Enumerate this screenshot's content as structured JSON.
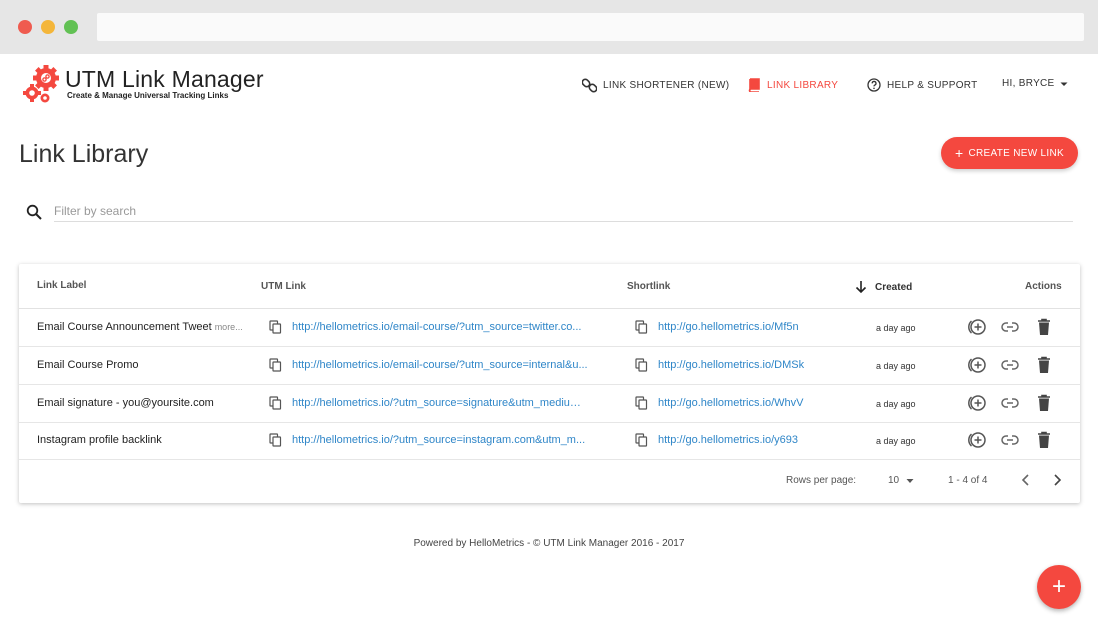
{
  "app": {
    "title": "UTM Link Manager",
    "subtitle": "Create & Manage Universal Tracking Links",
    "accent_color": "#f4483f",
    "link_color": "#2f86c8"
  },
  "nav": {
    "shortener": "LINK SHORTENER (NEW)",
    "library": "LINK LIBRARY",
    "help": "HELP & SUPPORT",
    "user": "HI, BRYCE"
  },
  "page": {
    "title": "Link Library",
    "create_button": "CREATE NEW LINK"
  },
  "search": {
    "placeholder": "Filter by search",
    "value": ""
  },
  "table": {
    "columns": {
      "label": "Link Label",
      "utm": "UTM Link",
      "short": "Shortlink",
      "created": "Created",
      "actions": "Actions"
    },
    "sort": {
      "column": "Created",
      "direction": "descending"
    },
    "rows": [
      {
        "label": "Email Course Announcement Tweet",
        "more": "more...",
        "utm": "http://hellometrics.io/email-course/?utm_source=twitter.co...",
        "short": "http://go.hellometrics.io/Mf5n",
        "created": "a day ago"
      },
      {
        "label": "Email Course Promo",
        "more": "",
        "utm": "http://hellometrics.io/email-course/?utm_source=internal&u...",
        "short": "http://go.hellometrics.io/DMSk",
        "created": "a day ago"
      },
      {
        "label": "Email signature - you@yoursite.com",
        "more": "",
        "utm": "http://hellometrics.io/?utm_source=signature&utm_medium...",
        "short": "http://go.hellometrics.io/WhvV",
        "created": "a day ago"
      },
      {
        "label": "Instagram profile backlink",
        "more": "",
        "utm": "http://hellometrics.io/?utm_source=instagram.com&utm_m...",
        "short": "http://go.hellometrics.io/y693",
        "created": "a day ago"
      }
    ],
    "row_icons": [
      "copy-icon",
      "add-circle-icon",
      "link-icon",
      "trash-icon"
    ],
    "pagination": {
      "rows_per_page_label": "Rows per page:",
      "rows_per_page": "10",
      "range": "1 - 4 of 4"
    }
  },
  "footer": {
    "text": "Powered by HelloMetrics - © UTM Link Manager 2016 - 2017"
  },
  "fab": {
    "label": "+"
  }
}
